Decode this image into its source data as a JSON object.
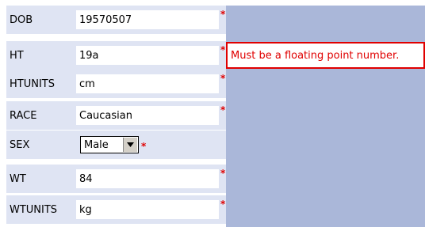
{
  "form": {
    "fields": [
      {
        "label": "DOB",
        "value": "19570507",
        "required": "*"
      },
      {
        "label": "HT",
        "value": "19a",
        "required": "*"
      },
      {
        "label": "HTUNITS",
        "value": "cm",
        "required": "*"
      },
      {
        "label": "RACE",
        "value": "Caucasian",
        "required": "*"
      },
      {
        "label": "SEX",
        "value": "Male",
        "required": "*"
      },
      {
        "label": "WT",
        "value": "84",
        "required": "*"
      },
      {
        "label": "WTUNITS",
        "value": "kg",
        "required": "*"
      }
    ],
    "error_message": "Must be a floating point number.",
    "colors": {
      "panel_bg": "#aab7d9",
      "row_bg": "#dfe4f3",
      "required": "#e00000",
      "error_border": "#e00000"
    },
    "icons": {
      "select_arrow": "chevron-down-icon"
    }
  }
}
